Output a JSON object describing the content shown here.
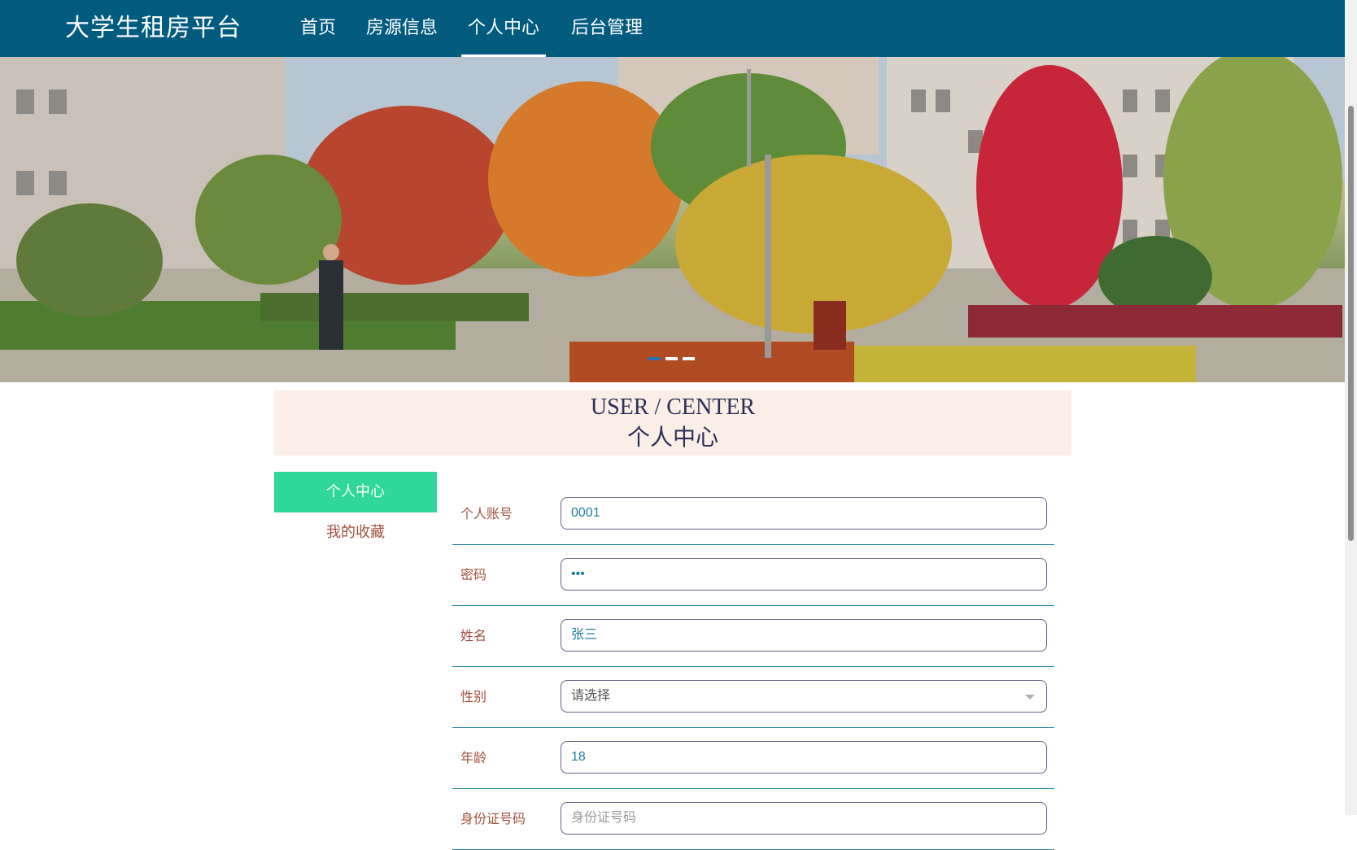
{
  "nav": {
    "brand": "大学生租房平台",
    "items": [
      {
        "label": "首页",
        "active": false
      },
      {
        "label": "房源信息",
        "active": false
      },
      {
        "label": "个人中心",
        "active": true
      },
      {
        "label": "后台管理",
        "active": false
      }
    ]
  },
  "banner": {
    "slide_count": 3,
    "active_slide": 1
  },
  "section": {
    "title_en": "USER / CENTER",
    "title_zh": "个人中心"
  },
  "sidebar": {
    "items": [
      {
        "label": "个人中心",
        "active": true
      },
      {
        "label": "我的收藏",
        "active": false
      }
    ]
  },
  "form": {
    "fields": [
      {
        "label": "个人账号",
        "value": "0001"
      },
      {
        "label": "密码",
        "value": "•••"
      },
      {
        "label": "姓名",
        "value": "张三"
      },
      {
        "label": "性别",
        "value": "请选择"
      },
      {
        "label": "年龄",
        "value": "18"
      },
      {
        "label": "身份证号码",
        "value": "身份证号码"
      }
    ]
  },
  "colors": {
    "nav_bg": "#005b7f",
    "side_active": "#2fd79b",
    "header_bg": "#fbeee7",
    "label": "#a0523f",
    "input_text": "#1f7e9e"
  }
}
